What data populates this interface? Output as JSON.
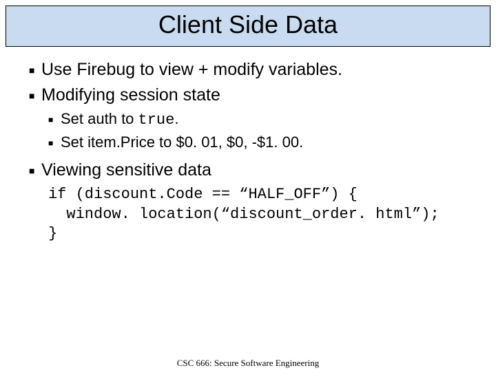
{
  "title": "Client Side Data",
  "bullets": {
    "b1": "Use Firebug to view + modify variables.",
    "b2": "Modifying session state",
    "b2a_pre": "Set auth to ",
    "b2a_code": "true",
    "b2a_post": ".",
    "b2b": "Set item.Price to $0. 01, $0, -$1. 00.",
    "b3": "Viewing sensitive data"
  },
  "code": {
    "l1": "if (discount.Code == “HALF_OFF”) {",
    "l2": "  window. location(“discount_order. html”);",
    "l3": "}"
  },
  "footer": "CSC 666: Secure Software Engineering"
}
